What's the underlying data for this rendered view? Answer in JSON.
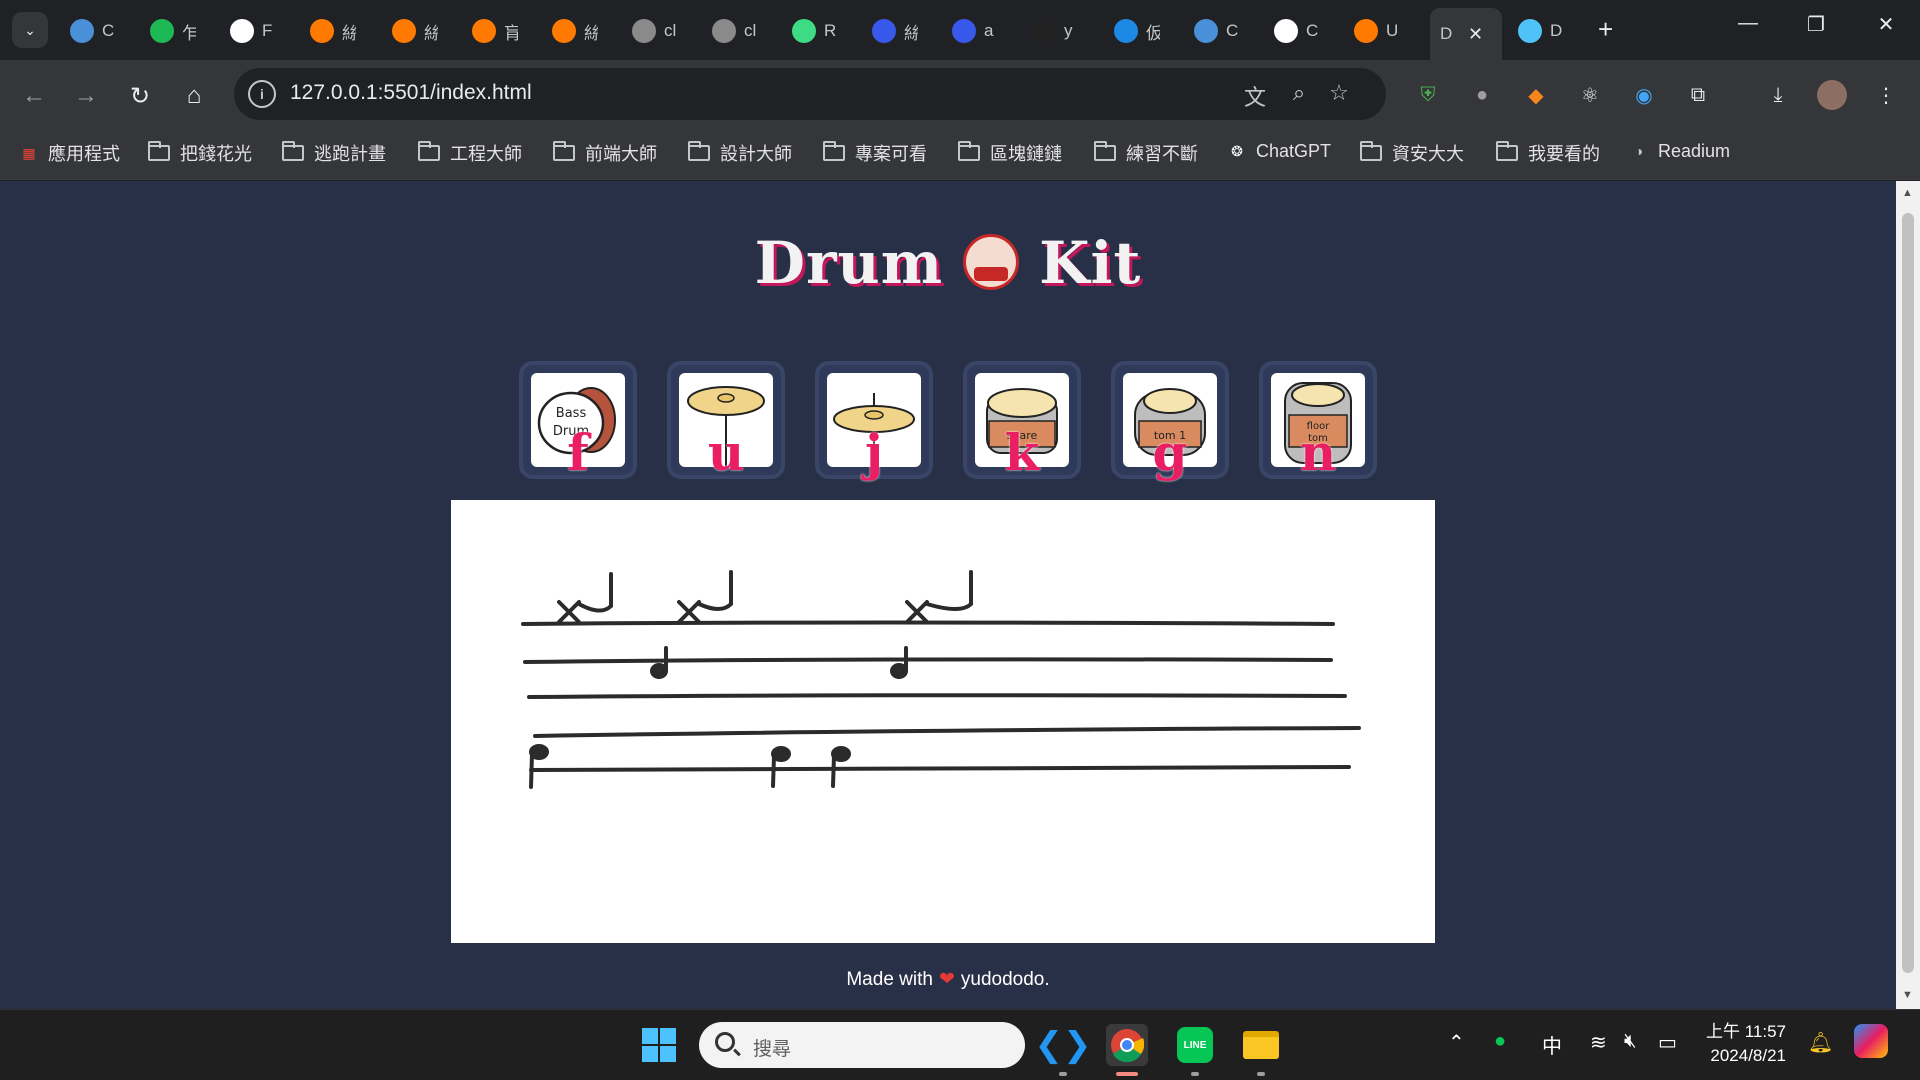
{
  "browser": {
    "tabs": [
      {
        "title": "C",
        "favicon": "monitor-icon",
        "color": "#4a90d9"
      },
      {
        "title": "乍",
        "favicon": "c-green-icon",
        "color": "#1db954"
      },
      {
        "title": "F",
        "favicon": "f-icon",
        "color": "#ffffff"
      },
      {
        "title": "絲",
        "favicon": "104-icon",
        "color": "#ff7a00"
      },
      {
        "title": "絲",
        "favicon": "104-icon",
        "color": "#ff7a00"
      },
      {
        "title": "肓",
        "favicon": "104-icon",
        "color": "#ff7a00"
      },
      {
        "title": "絲",
        "favicon": "104-icon",
        "color": "#ff7a00"
      },
      {
        "title": "cl",
        "favicon": "globe-icon",
        "color": "#8a8a8a"
      },
      {
        "title": "cl",
        "favicon": "figma-icon",
        "color": "#8a8a8a"
      },
      {
        "title": "R",
        "favicon": "r-icon",
        "color": "#3ddc84"
      },
      {
        "title": "絲",
        "favicon": "wordpress-icon",
        "color": "#3858e9"
      },
      {
        "title": "a",
        "favicon": "wordpress-icon",
        "color": "#3858e9"
      },
      {
        "title": "y",
        "favicon": "github-icon",
        "color": "#222222"
      },
      {
        "title": "仮",
        "favicon": "c-blue-icon",
        "color": "#1e88e5"
      },
      {
        "title": "C",
        "favicon": "monitor-icon",
        "color": "#4a90d9"
      },
      {
        "title": "C",
        "favicon": "openai-icon",
        "color": "#ffffff"
      },
      {
        "title": "U",
        "favicon": "104-icon",
        "color": "#ff7a00"
      },
      {
        "title": "D",
        "favicon": "none",
        "color": "#35363a",
        "active": true
      },
      {
        "title": "D",
        "favicon": "map-icon",
        "color": "#4fc3f7"
      }
    ],
    "new_tab": "+",
    "url": "127.0.0.1:5501/index.html"
  },
  "bookmarks": [
    {
      "label": "應用程式",
      "icon": "apps-grid-icon"
    },
    {
      "label": "把錢花光",
      "icon": "folder-icon"
    },
    {
      "label": "逃跑計畫",
      "icon": "folder-icon"
    },
    {
      "label": "工程大師",
      "icon": "folder-icon"
    },
    {
      "label": "前端大師",
      "icon": "folder-icon"
    },
    {
      "label": "設計大師",
      "icon": "folder-icon"
    },
    {
      "label": "專案可看",
      "icon": "folder-icon"
    },
    {
      "label": "區塊鏈鏈",
      "icon": "folder-icon"
    },
    {
      "label": "練習不斷",
      "icon": "folder-icon"
    },
    {
      "label": "ChatGPT",
      "icon": "openai-icon"
    },
    {
      "label": "資安大大",
      "icon": "folder-icon"
    },
    {
      "label": "我要看的",
      "icon": "folder-icon"
    },
    {
      "label": "Readium",
      "icon": "readium-icon"
    }
  ],
  "page": {
    "title_left": "Drum",
    "title_right": "Kit",
    "keys": [
      {
        "letter": "f",
        "instrument": "bass-drum",
        "caption": "Bass Drum"
      },
      {
        "letter": "u",
        "instrument": "crash-cymbal",
        "caption": ""
      },
      {
        "letter": "j",
        "instrument": "ride-cymbal",
        "caption": ""
      },
      {
        "letter": "k",
        "instrument": "snare",
        "caption": "snare"
      },
      {
        "letter": "g",
        "instrument": "tom-1",
        "caption": "tom 1"
      },
      {
        "letter": "n",
        "instrument": "floor-tom",
        "caption": "floor tom"
      }
    ],
    "footer_prefix": "Made with",
    "footer_author": "yudododo."
  },
  "taskbar": {
    "search_placeholder": "搜尋",
    "ime": "中",
    "time": "上午 11:57",
    "date": "2024/8/21"
  }
}
